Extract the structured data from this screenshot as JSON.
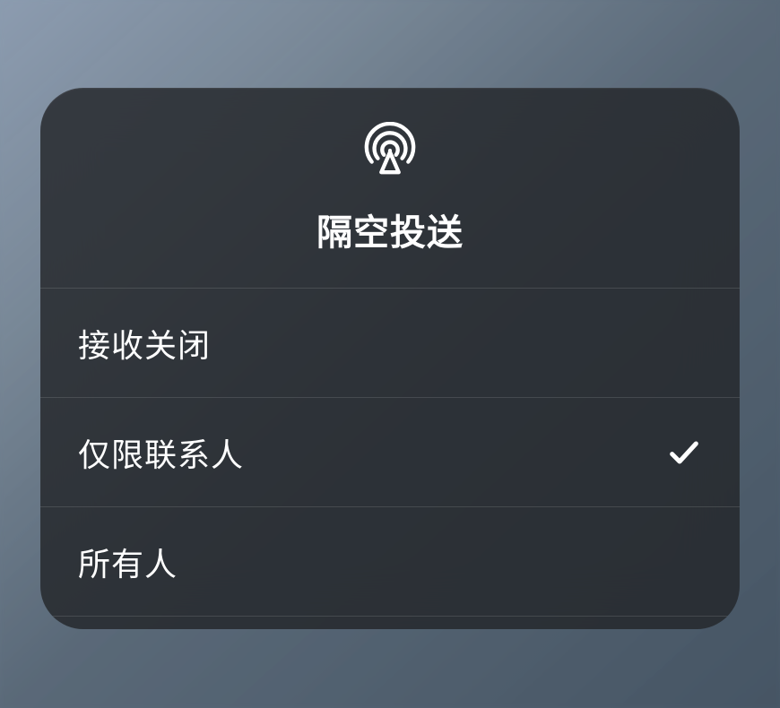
{
  "panel": {
    "title": "隔空投送",
    "options": [
      {
        "label": "接收关闭",
        "selected": false
      },
      {
        "label": "仅限联系人",
        "selected": true
      },
      {
        "label": "所有人",
        "selected": false
      }
    ]
  }
}
